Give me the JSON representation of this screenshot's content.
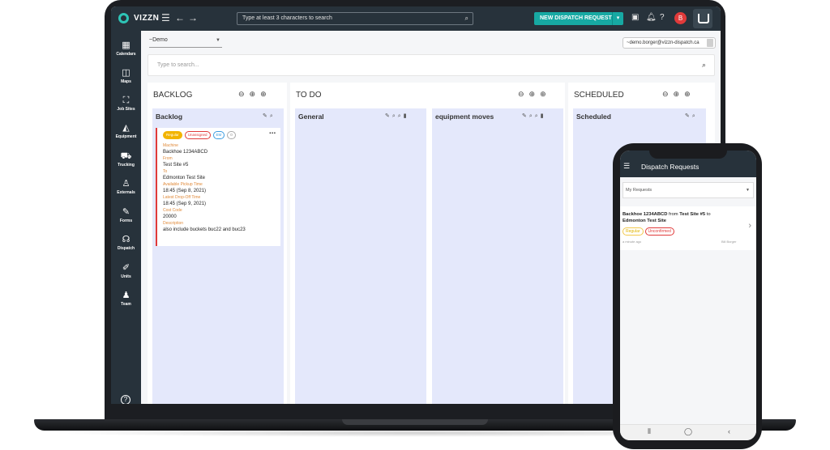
{
  "app": {
    "brand": "VIZZN",
    "top_search_placeholder": "Type at least 3 characters to search",
    "new_dispatch_label": "NEW DISPATCH REQUEST",
    "avatar_initial": "B",
    "org_selected": "~Demo",
    "user_email": "~demo.borger@vizzn-dispatch.ca",
    "board_search_placeholder": "Type to search..."
  },
  "sidebar": {
    "items": [
      {
        "label": "Calendars",
        "icon": "calendar-icon"
      },
      {
        "label": "Maps",
        "icon": "map-icon"
      },
      {
        "label": "Job Sites",
        "icon": "job-site-icon"
      },
      {
        "label": "Equipment",
        "icon": "excavator-icon"
      },
      {
        "label": "Trucking",
        "icon": "truck-icon"
      },
      {
        "label": "Externals",
        "icon": "external-icon"
      },
      {
        "label": "Forms",
        "icon": "form-icon"
      },
      {
        "label": "Dispatch",
        "icon": "headset-icon"
      },
      {
        "label": "Units",
        "icon": "pencil-icon"
      },
      {
        "label": "Team",
        "icon": "team-icon"
      }
    ]
  },
  "board": {
    "columns": [
      {
        "title": "BACKLOG",
        "lanes": [
          {
            "title": "Backlog",
            "cards": [
              {
                "tags": [
                  "Regular",
                  "Unassigned",
                  "EM",
                  "0"
                ],
                "fields": [
                  {
                    "label": "Machine",
                    "value": "Backhoe 1234ABCD"
                  },
                  {
                    "label": "From",
                    "value": "Test Site #5"
                  },
                  {
                    "label": "To",
                    "value": "Edmonton Test Site"
                  },
                  {
                    "label": "Available Pickup Time",
                    "value": "18:45 (Sep 8, 2021)"
                  },
                  {
                    "label": "Latest Drop-Off Time",
                    "value": "18:45 (Sep 9, 2021)"
                  },
                  {
                    "label": "Cost Code",
                    "value": "20000"
                  },
                  {
                    "label": "Description",
                    "value": "also include buckets buc22 and buc23"
                  }
                ]
              }
            ]
          }
        ]
      },
      {
        "title": "TO DO",
        "lanes": [
          {
            "title": "General"
          },
          {
            "title": "equipment moves"
          }
        ]
      },
      {
        "title": "SCHEDULED",
        "lanes": [
          {
            "title": "Scheduled"
          }
        ]
      }
    ]
  },
  "phone": {
    "title": "Dispatch Requests",
    "filter_selected": "My Requests",
    "request": {
      "machine": "Backhoe 1234ABCD",
      "from_word": "from",
      "from_site": "Test Site #5",
      "to_word": "to",
      "to_site": "Edmonton Test Site",
      "tags": [
        "Regular",
        "Unconfirmed"
      ],
      "age": "a minute ago",
      "user": "Bill Borger"
    }
  }
}
